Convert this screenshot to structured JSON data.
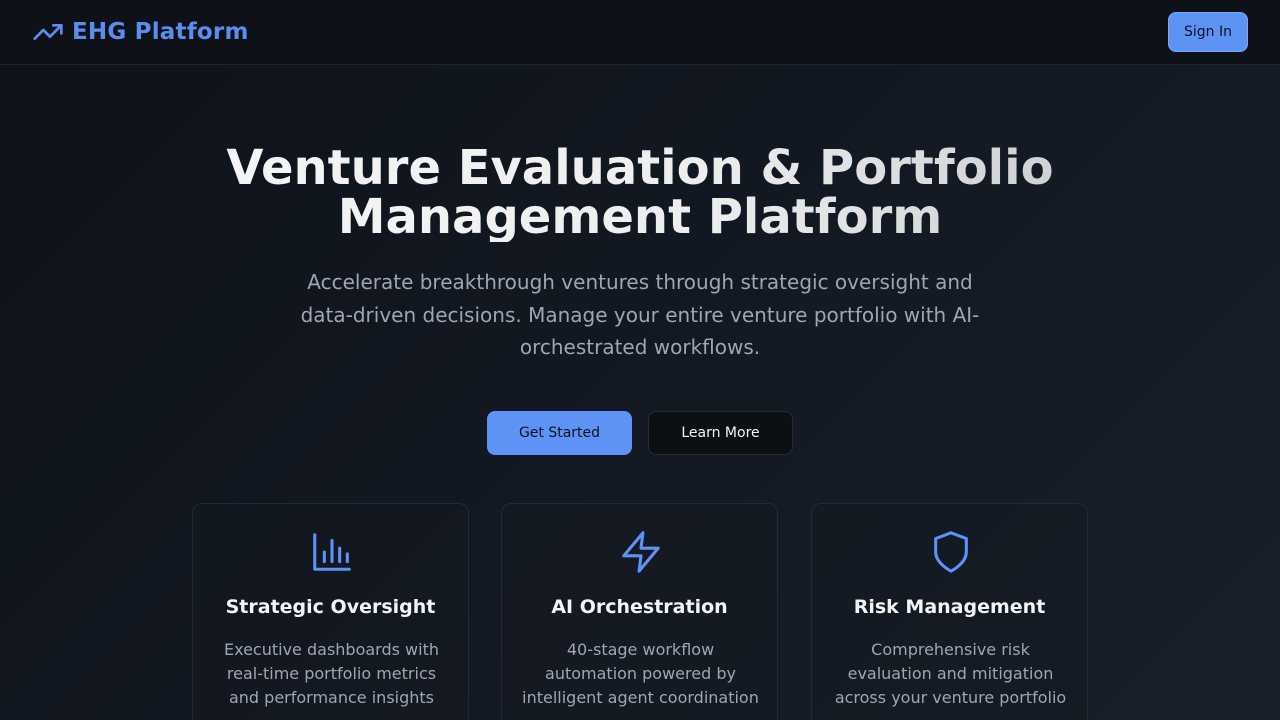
{
  "header": {
    "brand_name": "EHG Platform",
    "brand_icon": "trending-up-icon",
    "sign_in_label": "Sign In"
  },
  "hero": {
    "title_line1": "Venture Evaluation & Portfolio",
    "title_line2": "Management Platform",
    "subtitle": "Accelerate breakthrough ventures through strategic oversight and data-driven decisions. Manage your entire venture portfolio with AI-orchestrated workflows.",
    "primary_button": "Get Started",
    "secondary_button": "Learn More"
  },
  "features": [
    {
      "icon": "bar-chart-icon",
      "title": "Strategic Oversight",
      "description": "Executive dashboards with real-time portfolio metrics and performance insights"
    },
    {
      "icon": "lightning-icon",
      "title": "AI Orchestration",
      "description": "40-stage workflow automation powered by intelligent agent coordination"
    },
    {
      "icon": "shield-icon",
      "title": "Risk Management",
      "description": "Comprehensive risk evaluation and mitigation across your venture portfolio"
    }
  ],
  "colors": {
    "accent": "#5e93f5",
    "brand_text": "#5b8def",
    "background": "#121821",
    "muted_text": "#9ea6b3"
  }
}
